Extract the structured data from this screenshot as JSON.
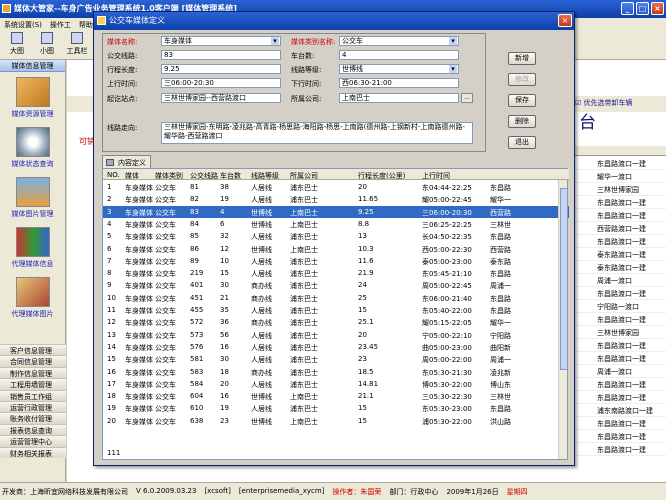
{
  "main": {
    "title": "媒体大管家--车身广告业务管理系统1.0客户端    [媒体管理系统]",
    "menus": [
      "系统设置(S)",
      "操作工",
      "帮助"
    ],
    "toolbar": [
      "大图",
      "小图",
      "工具栏"
    ]
  },
  "nav": {
    "header": "媒体信息管理",
    "items": [
      "媒体资源管理",
      "媒体状态查询",
      "媒体图片管理",
      "代理媒体信息",
      "代理媒体图片"
    ],
    "list": [
      "客户信息管理",
      "合同信息管理",
      "制作信息管理",
      "工程用墙管理",
      "销售员工作组",
      "运营行政管理",
      "账务收付管理",
      "报表信息查询",
      "运营管理中心",
      "财务相关报表"
    ]
  },
  "bg": {
    "option": "优先选带卸车辆",
    "big": "台",
    "leftred": "可销",
    "rows": [
      "东昌路渡口一建",
      "耀华一渡口",
      "三林世博家园",
      "东昌路渡口一建",
      "东昌路渡口一建",
      "西营路渡口一建",
      "东昌路渡口一建",
      "泰东路渡口一建",
      "泰东路渡口一建",
      "周浦一渡口",
      "东昌路渡口一建",
      "宁阳路一渡口",
      "东昌路渡口一建",
      "三林世博家园",
      "东昌路渡口一建",
      "东昌路渡口一建",
      "周浦一渡口",
      "东昌路渡口一建",
      "东昌路渡口一建",
      "浦东南路渡口一建",
      "东昌路渡口一建",
      "东昌路渡口一建",
      "东昌路渡口一建"
    ]
  },
  "status": {
    "company": "开发商：上海昕宜网络科技发展有限公司",
    "version": "V 6.0.2009.03.23",
    "user_code": "[xcsoft]",
    "server": "[enterprisemedia_xycm]",
    "operator": "操作者：朱国荣",
    "dept": "部门：行政中心",
    "date": "2009年1月26日",
    "weekday": "星期四"
  },
  "dialog": {
    "title": "公交车媒体定义",
    "form": {
      "media_name_label": "媒体名称:",
      "media_name_value": "车身媒体",
      "media_type_label": "媒体类别名称:",
      "media_type_value": "公交车",
      "bus_line_label": "公交线路:",
      "bus_line_value": "83",
      "vehicle_count_label": "车台数:",
      "vehicle_count_value": "4",
      "route_length_label": "行程长度:",
      "route_length_value": "9.25",
      "line_grade_label": "线路等级:",
      "line_grade_value": "世博线",
      "up_time_label": "上行时间:",
      "up_time_value": "三06:00-20:30",
      "down_time_label": "下行时间:",
      "down_time_value": "西06:30-21:00",
      "start_end_label": "起讫站点:",
      "start_end_value": "三林世博家园--西营路渡口",
      "company_label": "所属公司:",
      "company_value": "上南巴士",
      "route_label": "线路走向:",
      "route_value": "三林世博家园-东明路-凌兆路-高青路-杨思路-海阳路-杨思-上南路(德州路-上钢新村-上南路德州路-耀华路-西营路渡口"
    },
    "buttons": [
      "新增",
      "修改",
      "保存",
      "删除",
      "退出"
    ],
    "tab": "内容定义",
    "grid": {
      "columns": [
        "NO.",
        "媒体",
        "媒体类别",
        "公交线路",
        "车台数",
        "线路等级",
        "所属公司",
        "行程长度(公里)",
        "上行时间",
        ""
      ],
      "rows": [
        [
          "1",
          "车身媒体",
          "公交车",
          "81",
          "38",
          "人居线",
          "浦东巴士",
          "20",
          "东04:44-22:25",
          "东昌路"
        ],
        [
          "2",
          "车身媒体",
          "公交车",
          "82",
          "19",
          "人居线",
          "浦东巴士",
          "11.65",
          "耀05:00-22:45",
          "耀华一"
        ],
        [
          "3",
          "车身媒体",
          "公交车",
          "83",
          "4",
          "世博线",
          "上南巴士",
          "9.25",
          "三06:00-20:30",
          "西营路"
        ],
        [
          "4",
          "车身媒体",
          "公交车",
          "84",
          "6",
          "世博线",
          "上南巴士",
          "8.8",
          "三06:25-22:25",
          "三林世"
        ],
        [
          "5",
          "车身媒体",
          "公交车",
          "85",
          "32",
          "人居线",
          "浦东巴士",
          "13",
          "长04:50-22:35",
          "东昌路"
        ],
        [
          "6",
          "车身媒体",
          "公交车",
          "86",
          "12",
          "世博线",
          "上南巴士",
          "10.3",
          "西05:00-22:30",
          "西营路"
        ],
        [
          "7",
          "车身媒体",
          "公交车",
          "89",
          "10",
          "人居线",
          "浦东巴士",
          "11.6",
          "泰05:00-23:00",
          "泰东路"
        ],
        [
          "8",
          "车身媒体",
          "公交车",
          "219",
          "15",
          "人居线",
          "浦东巴士",
          "21.9",
          "东05:45-21:10",
          "东昌路"
        ],
        [
          "9",
          "车身媒体",
          "公交车",
          "401",
          "30",
          "商办线",
          "浦东巴士",
          "24",
          "周05:00-22:45",
          "周浦一"
        ],
        [
          "10",
          "车身媒体",
          "公交车",
          "451",
          "21",
          "商办线",
          "浦东巴士",
          "25",
          "东06:00-21:40",
          "东昌路"
        ],
        [
          "11",
          "车身媒体",
          "公交车",
          "455",
          "35",
          "人居线",
          "浦东巴士",
          "15",
          "东05:40-22:00",
          "东昌路"
        ],
        [
          "12",
          "车身媒体",
          "公交车",
          "572",
          "36",
          "商办线",
          "浦东巴士",
          "25.1",
          "耀05:15-22:05",
          "耀华一"
        ],
        [
          "13",
          "车身媒体",
          "公交车",
          "573",
          "56",
          "人居线",
          "浦东巴士",
          "20",
          "宁05:00-22:10",
          "宁阳路"
        ],
        [
          "14",
          "车身媒体",
          "公交车",
          "576",
          "16",
          "人居线",
          "浦东巴士",
          "23.45",
          "曲05:00-23:00",
          "曲阳新"
        ],
        [
          "15",
          "车身媒体",
          "公交车",
          "581",
          "30",
          "人居线",
          "浦东巴士",
          "23",
          "周05:00-22:00",
          "周浦一"
        ],
        [
          "16",
          "车身媒体",
          "公交车",
          "583",
          "18",
          "商办线",
          "浦东巴士",
          "18.5",
          "东05:30-21:30",
          "凌兆新"
        ],
        [
          "17",
          "车身媒体",
          "公交车",
          "584",
          "20",
          "人居线",
          "浦东巴士",
          "14.81",
          "博05:30-22:00",
          "博山东"
        ],
        [
          "18",
          "车身媒体",
          "公交车",
          "604",
          "16",
          "世博线",
          "上南巴士",
          "21.1",
          "三05:30-22:30",
          "三林世"
        ],
        [
          "19",
          "车身媒体",
          "公交车",
          "610",
          "19",
          "人居线",
          "浦东巴士",
          "15",
          "东05:30-23:00",
          "东昌路"
        ],
        [
          "20",
          "车身媒体",
          "公交车",
          "638",
          "23",
          "世博线",
          "上南巴士",
          "15",
          "浦05:30-22:00",
          "洪山路"
        ]
      ],
      "footer": "111"
    }
  }
}
